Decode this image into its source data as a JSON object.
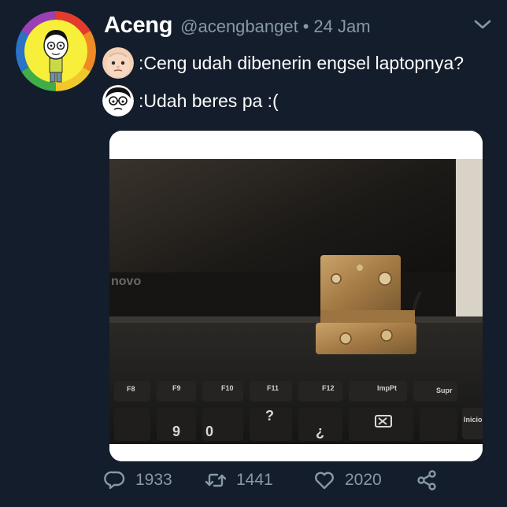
{
  "user": {
    "name": "Aceng",
    "handle": "@acengbanget",
    "separator": "•",
    "time": "24 Jam"
  },
  "dialog": [
    {
      "speaker_icon": "baby-face-icon",
      "text": ":Ceng udah dibenerin engsel laptopnya?"
    },
    {
      "speaker_icon": "cartoon-face-icon",
      "text": ":Udah beres pa :("
    }
  ],
  "photo": {
    "brand_text": "novo",
    "keys": [
      "F8",
      "F9",
      "F10",
      "F11",
      "F12",
      "ImpPt",
      "Supr",
      "Inicio"
    ],
    "number_keys": [
      "9",
      "0",
      "?",
      "¿"
    ]
  },
  "actions": {
    "reply_count": "1933",
    "retweet_count": "1441",
    "like_count": "2020"
  },
  "colors": {
    "background": "#141d2b",
    "text": "#ffffff",
    "muted": "#8899a6"
  }
}
